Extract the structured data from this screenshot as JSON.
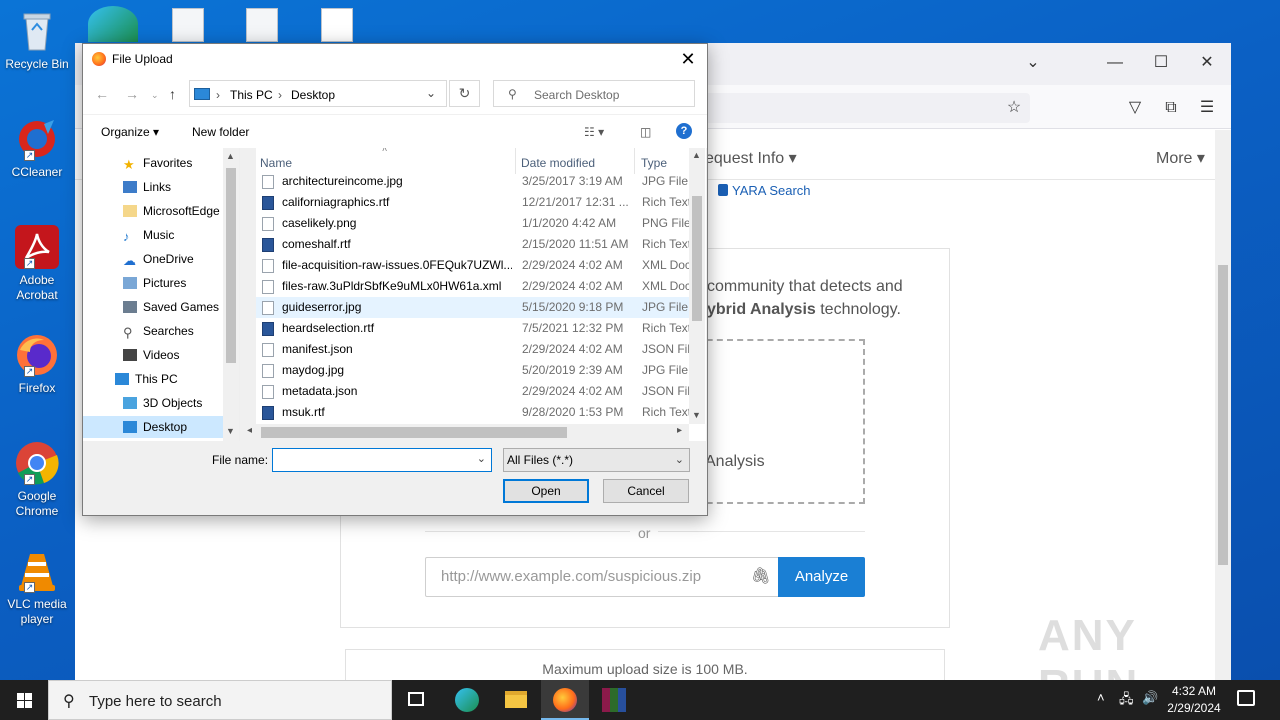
{
  "desktop": {
    "icons": [
      {
        "label": "Recycle Bin"
      },
      {
        "label": "CCleaner"
      },
      {
        "label": "Adobe Acrobat"
      },
      {
        "label": "Firefox"
      },
      {
        "label": "Google Chrome"
      },
      {
        "label": "VLC media player"
      }
    ]
  },
  "browser": {
    "nav_request_info": "equest Info",
    "nav_more": "More",
    "yara_search": "YARA Search",
    "hero_line1": "community that detects and",
    "hero_line2_bold": "ybrid Analysis",
    "hero_line2_rest": "technology.",
    "dropzone_text": "Analysis",
    "or_text": "or",
    "url_placeholder": "http://www.example.com/suspicious.zip",
    "analyze_label": "Analyze",
    "max_upload": "Maximum upload size is 100 MB.",
    "watermark": "ANY RUN"
  },
  "dialog": {
    "title": "File Upload",
    "breadcrumb": [
      "This PC",
      "Desktop"
    ],
    "search_placeholder": "Search Desktop",
    "organize_label": "Organize",
    "new_folder_label": "New folder",
    "tree": [
      {
        "label": "Favorites"
      },
      {
        "label": "Links"
      },
      {
        "label": "MicrosoftEdge"
      },
      {
        "label": "Music"
      },
      {
        "label": "OneDrive"
      },
      {
        "label": "Pictures"
      },
      {
        "label": "Saved Games"
      },
      {
        "label": "Searches"
      },
      {
        "label": "Videos"
      },
      {
        "label": "This PC"
      },
      {
        "label": "3D Objects"
      },
      {
        "label": "Desktop"
      }
    ],
    "columns": {
      "name": "Name",
      "date": "Date modified",
      "type": "Type"
    },
    "files": [
      {
        "name": "architectureincome.jpg",
        "date": "3/25/2017 3:19 AM",
        "type": "JPG File",
        "kind": "img"
      },
      {
        "name": "californiagraphics.rtf",
        "date": "12/21/2017 12:31 ...",
        "type": "Rich Text",
        "kind": "rtf"
      },
      {
        "name": "caselikely.png",
        "date": "1/1/2020 4:42 AM",
        "type": "PNG File",
        "kind": "img"
      },
      {
        "name": "comeshalf.rtf",
        "date": "2/15/2020 11:51 AM",
        "type": "Rich Text",
        "kind": "rtf"
      },
      {
        "name": "file-acquisition-raw-issues.0FEQuk7UZWl...",
        "date": "2/29/2024 4:02 AM",
        "type": "XML Doc",
        "kind": "doc"
      },
      {
        "name": "files-raw.3uPldrSbfKe9uMLx0HW61a.xml",
        "date": "2/29/2024 4:02 AM",
        "type": "XML Doc",
        "kind": "doc"
      },
      {
        "name": "guideserror.jpg",
        "date": "5/15/2020 9:18 PM",
        "type": "JPG File",
        "kind": "img"
      },
      {
        "name": "heardselection.rtf",
        "date": "7/5/2021 12:32 PM",
        "type": "Rich Text",
        "kind": "rtf"
      },
      {
        "name": "manifest.json",
        "date": "2/29/2024 4:02 AM",
        "type": "JSON File",
        "kind": "doc"
      },
      {
        "name": "maydog.jpg",
        "date": "5/20/2019 2:39 AM",
        "type": "JPG File",
        "kind": "img"
      },
      {
        "name": "metadata.json",
        "date": "2/29/2024 4:02 AM",
        "type": "JSON File",
        "kind": "doc"
      },
      {
        "name": "msuk.rtf",
        "date": "9/28/2020 1:53 PM",
        "type": "Rich Text",
        "kind": "rtf"
      }
    ],
    "filename_label": "File name:",
    "filename_value": "",
    "filter_value": "All Files (*.*)",
    "open_label": "Open",
    "cancel_label": "Cancel"
  },
  "taskbar": {
    "search_placeholder": "Type here to search",
    "time": "4:32 AM",
    "date": "2/29/2024"
  }
}
